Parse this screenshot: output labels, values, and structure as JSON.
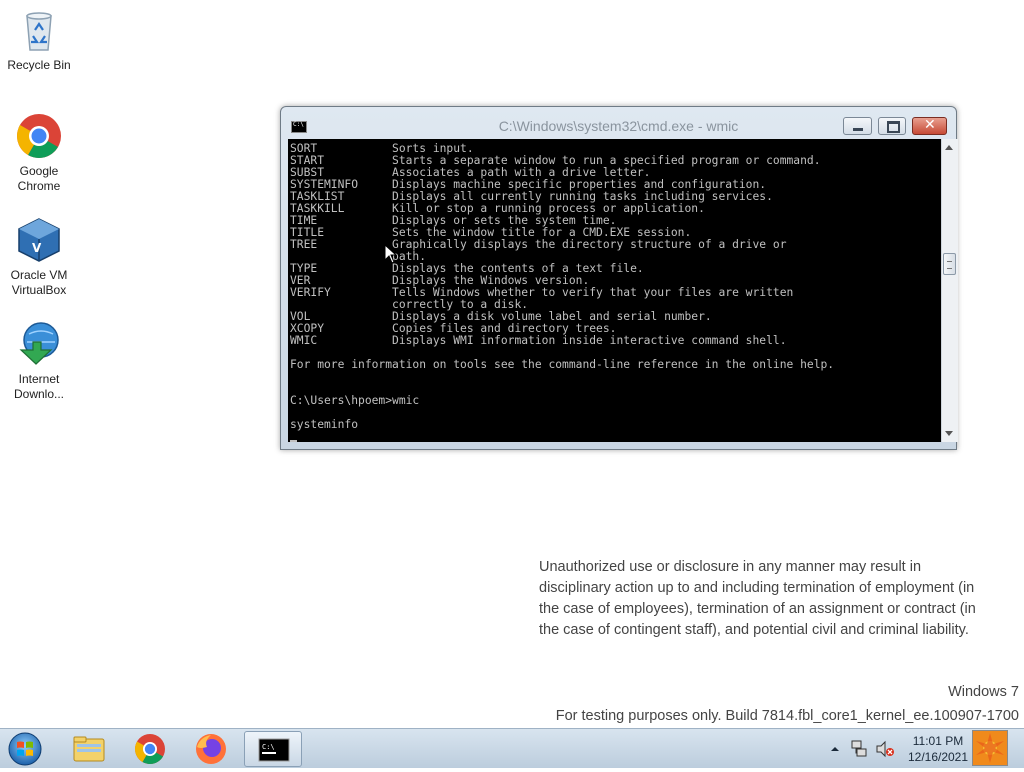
{
  "desktop": {
    "icons": [
      {
        "label_line1": "Recycle Bin",
        "label_line2": "",
        "icon": "recycle-bin-icon"
      },
      {
        "label_line1": "Google",
        "label_line2": "Chrome",
        "icon": "chrome-icon"
      },
      {
        "label_line1": "Oracle VM",
        "label_line2": "VirtualBox",
        "icon": "virtualbox-icon"
      },
      {
        "label_line1": "Internet",
        "label_line2": "Downlo...",
        "icon": "internet-download-manager-icon"
      }
    ]
  },
  "cmd_window": {
    "title": "C:\\Windows\\system32\\cmd.exe - wmic",
    "lines": [
      "SORT           Sorts input.",
      "START          Starts a separate window to run a specified program or command.",
      "SUBST          Associates a path with a drive letter.",
      "SYSTEMINFO     Displays machine specific properties and configuration.",
      "TASKLIST       Displays all currently running tasks including services.",
      "TASKKILL       Kill or stop a running process or application.",
      "TIME           Displays or sets the system time.",
      "TITLE          Sets the window title for a CMD.EXE session.",
      "TREE           Graphically displays the directory structure of a drive or",
      "               path.",
      "TYPE           Displays the contents of a text file.",
      "VER            Displays the Windows version.",
      "VERIFY         Tells Windows whether to verify that your files are written",
      "               correctly to a disk.",
      "VOL            Displays a disk volume label and serial number.",
      "XCOPY          Copies files and directory trees.",
      "WMIC           Displays WMI information inside interactive command shell.",
      "",
      "For more information on tools see the command-line reference in the online help.",
      "",
      "",
      "C:\\Users\\hpoem>wmic",
      "",
      "systeminfo"
    ]
  },
  "watermark": {
    "notice_line1": "Unauthorized use or disclosure in any manner may result in",
    "notice_line2": "disciplinary action up to and including termination of employment (in",
    "notice_line3": "the case of employees), termination of an assignment or contract (in",
    "notice_line4": "the case of contingent staff), and potential civil and criminal liability.",
    "windows_version": "Windows 7",
    "build": "For testing purposes only. Build 7814.fbl_core1_kernel_ee.100907-1700"
  },
  "taskbar": {
    "pinned": [
      "windows-explorer-icon",
      "chrome-icon",
      "firefox-icon",
      "cmd-icon"
    ],
    "clock_time": "11:01 PM",
    "clock_date": "12/16/2021"
  }
}
